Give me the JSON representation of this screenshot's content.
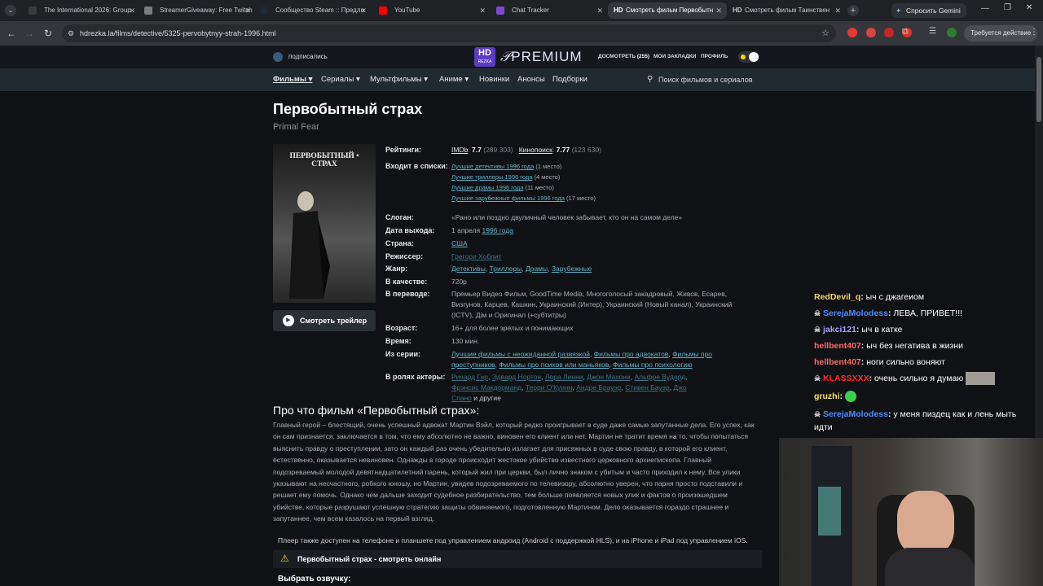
{
  "browser": {
    "tabs": [
      {
        "title": "The International 2026: Group",
        "favicon_color": "#3b3b3b"
      },
      {
        "title": "StreamerGiveaway: Free Twitch",
        "favicon_color": "#7c7c7c"
      },
      {
        "title": "Сообщество Steam :: Предло",
        "favicon_color": "#1b2838"
      },
      {
        "title": "YouTube",
        "favicon_color": "#ff0000"
      },
      {
        "title": "Chat Tracker",
        "favicon_color": "#7b4ad1"
      },
      {
        "title": "Смотреть фильм Первобытн",
        "favicon_label": "HD"
      },
      {
        "title": "Смотреть фильм Таинствен",
        "favicon_label": "HD"
      }
    ],
    "gemini_button": "Спросить Gemini",
    "url": "hdrezka.la/films/detective/5325-pervobytnyy-strah-1996.html",
    "profile_button": "Требуется действие"
  },
  "site": {
    "subscribe": "подписались",
    "logo_hd": "HD",
    "logo_rezka": "REZKA",
    "logo_premium": "PREMIUM",
    "top_links": [
      {
        "label": "ДОСМОТРЕТЬ",
        "count": "(255)"
      },
      {
        "label": "МОИ ЗАКЛАДКИ"
      },
      {
        "label": "ПРОФИЛЬ"
      }
    ],
    "nav": [
      "Фильмы",
      "Сериалы",
      "Мультфильмы",
      "Аниме",
      "Новинки",
      "Анонсы",
      "Подборки"
    ],
    "search_placeholder": "Поиск фильмов и сериалов"
  },
  "film": {
    "title": "Первобытный страх",
    "original_title": "Primal Fear",
    "poster_text": "ПЕРВОБЫТНЫЙ • СТРАХ",
    "trailer_button": "Смотреть трейлер",
    "labels": {
      "ratings": "Рейтинги:",
      "lists": "Входит в списки:",
      "slogan": "Слоган:",
      "release": "Дата выхода:",
      "country": "Страна:",
      "director": "Режиссер:",
      "genre": "Жанр:",
      "quality": "В качестве:",
      "translation": "В переводе:",
      "age": "Возраст:",
      "time": "Время:",
      "series": "Из серии:",
      "actors": "В ролях актеры:"
    },
    "imdb_label": "IMDb",
    "imdb_value": "7.7",
    "imdb_votes": "(289 303)",
    "kp_label": "Кинопоиск",
    "kp_value": "7.77",
    "kp_votes": "(123 630)",
    "lists": [
      {
        "link": "Лучшие детективы 1996 года",
        "place": "(1 место)"
      },
      {
        "link": "Лучшие триллеры 1996 года",
        "place": "(4 место)"
      },
      {
        "link": "Лучшие драмы 1996 года",
        "place": "(11 место)"
      },
      {
        "link": "Лучшие зарубежные фильмы 1996 года",
        "place": "(17 место)"
      }
    ],
    "slogan": "«Рано или поздно двуличный человек забывает, кто он на самом деле»",
    "release_day": "1 апреля",
    "release_year": "1996 года",
    "country": "США",
    "director": "Грегори Хоблит",
    "genres": [
      "Детективы",
      "Триллеры",
      "Драмы",
      "Зарубежные"
    ],
    "quality": "720p",
    "translation": "Премьер Видео Фильм, GoodTime Media, Многоголосый закадровый, Живов, Есарев, Визгунов, Карцев, Кашкин, Украинский (Интер), Украинский (Новый канал), Украинский (ICTV), Дім и Оригинал (+субтитры)",
    "age": "16+ для более зрелых и понимающих",
    "time": "130 мин.",
    "series": [
      "Лучшие фильмы с неожиданной развязкой",
      "Фильмы про адвокатов",
      "Фильмы про преступников",
      "Фильмы про психов или маньяков",
      "Фильмы про психологию"
    ],
    "actors": [
      "Ричард Гир",
      "Эдвард Нортон",
      "Лора Линни",
      "Джон Махони",
      "Альфре Вудард",
      "Фрэнсис Макдорманд",
      "Терри О'Куинн",
      "Андре Брауэр",
      "Стивен Бауэр",
      "Джо Спано"
    ],
    "actors_more": "и другие",
    "about_title": "Про что фильм «Первобытный страх»:",
    "about_text": "Главный герой – блестящий, очень успешный адвокат Мартин Вэйл, который редко проигрывает в суде даже самые запутанные дела. Его успех, как он сам признается, заключается в том, что ему абсолютно не важно, виновен его клиент или нет. Мартин не тратит время на то, чтобы попытаться выяснить правду о преступлении, зато он каждый раз очень убедительно излагает для присяжных в суде свою правду, в которой его клиент, естественно, оказывается невиновен. Однажды в городе происходит жестокое убийство известного церковного архиепископа. Главный подозреваемый молодой девятнадцатилетний парень, который жил при церкви, был лично знаком с убитым и часто приходил к нему. Все улики указывают на несчастного, робкого юношу, но Мартин, увидев подозреваемого по телевизору, абсолютно уверен, что парня просто подставили и решает ему помочь. Однако чем дальше заходит судебное разбирательство, тем больше появляется новых улик и фактов о произошедшем убийстве, которые разрушают успешную стратегию защиты обвиняемого, подготовленную Мартином. Дело оказывается гораздо страшнее и запутаннее, чем всем казалось на первый взгляд.",
    "player_note": "Плеер также доступен на телефоне и планшете под управлением андроид (Android с поддержкой HLS), и на iPhone и iPad под управлением iOS.",
    "watch_title": "Первобытный страх - смотреть онлайн",
    "voice_title": "Выбрать озвучку:"
  },
  "chat": [
    {
      "nick": "RedDevil_q",
      "color": "#f5d36b",
      "msg": "ыч с джагеиом",
      "badge": false
    },
    {
      "nick": "SerejaMolodess",
      "color": "#4c8cff",
      "msg": "ЛЕВА, ПРИВЕТ!!!",
      "badge": true
    },
    {
      "nick": "jakci121",
      "color": "#b39cff",
      "msg": "ыч в катке",
      "badge": true
    },
    {
      "nick": "hellbent407",
      "color": "#ff6a6a",
      "msg": "ыч без негатива в жизни",
      "badge": false
    },
    {
      "nick": "hellbent407",
      "color": "#ff6a6a",
      "msg": "ноги сильно воняют",
      "badge": false
    },
    {
      "nick": "KLASSXXX",
      "color": "#ff2b2b",
      "msg": "очень сильно я думаю",
      "badge": true
    },
    {
      "nick": "gruzhi",
      "color": "#ffe45c",
      "msg": "",
      "badge": false
    },
    {
      "nick": "SerejaMolodess",
      "color": "#4c8cff",
      "msg": "у меня пиздец как и лень мыть идти",
      "badge": true
    }
  ]
}
